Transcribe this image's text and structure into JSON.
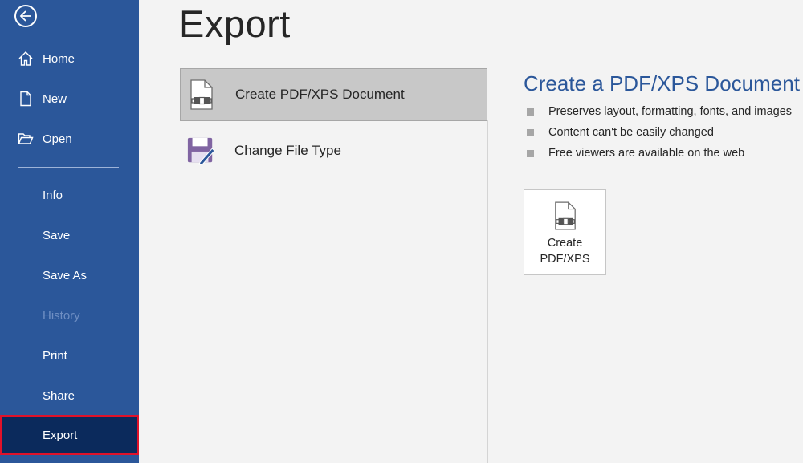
{
  "sidebar": {
    "back_icon": "arrow-left-circle-icon",
    "items": [
      {
        "label": "Home",
        "icon": "home-icon"
      },
      {
        "label": "New",
        "icon": "new-document-icon"
      },
      {
        "label": "Open",
        "icon": "folder-open-icon"
      },
      {
        "label": "Info"
      },
      {
        "label": "Save"
      },
      {
        "label": "Save As"
      },
      {
        "label": "History",
        "state": "disabled"
      },
      {
        "label": "Print"
      },
      {
        "label": "Share"
      },
      {
        "label": "Export",
        "state": "selected"
      }
    ],
    "accent_color": "#2b579a",
    "selected_color": "#0b2a5c",
    "highlight_border_color": "#e0122a"
  },
  "main": {
    "title": "Export",
    "options": [
      {
        "label": "Create PDF/XPS Document",
        "icon": "pdf-document-icon",
        "selected": true
      },
      {
        "label": "Change File Type",
        "icon": "save-as-file-icon",
        "selected": false
      }
    ]
  },
  "detail": {
    "title": "Create a PDF/XPS Document",
    "bullets": [
      "Preserves layout, formatting, fonts, and images",
      "Content can't be easily changed",
      "Free viewers are available on the web"
    ],
    "button_line1": "Create",
    "button_line2": "PDF/XPS",
    "button_icon": "pdf-document-icon"
  }
}
